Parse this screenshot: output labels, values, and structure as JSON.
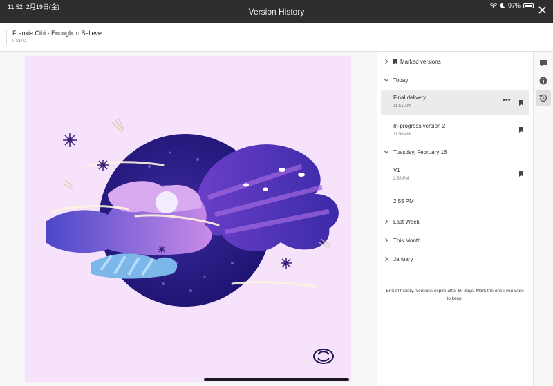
{
  "status": {
    "time": "11:52",
    "date": "2月19日(金)",
    "battery": "97%"
  },
  "window": {
    "title": "Version History"
  },
  "document": {
    "name": "Frankie Cihi - Enough to Believe",
    "type": "PSDC"
  },
  "artwork": {
    "signature": "Frankie Cihi"
  },
  "history": {
    "marked_label": "Marked versions",
    "groups": {
      "today": "Today",
      "feb16": "Tuesday, February 16",
      "last_week": "Last Week",
      "this_month": "This Month",
      "january": "January"
    },
    "versions": [
      {
        "name": "Final delivery",
        "time": "11:51 AM",
        "selected": true
      },
      {
        "name": "In-progress version 2",
        "time": "11:50 AM",
        "selected": false
      },
      {
        "name": "V1",
        "time": "2:58 PM",
        "selected": false
      },
      {
        "name": "2:55 PM",
        "time": "",
        "selected": false
      }
    ],
    "end_note": "End of history. Versions expire after 60 days. Mark the ones you want to keep."
  },
  "rail": {
    "items": [
      "comments-icon",
      "info-icon",
      "history-icon"
    ],
    "active": "history-icon"
  },
  "colors": {
    "header_bg": "#2e2e2e",
    "canvas_bg": "#f6e2fb",
    "selected_row": "#ebebeb"
  }
}
